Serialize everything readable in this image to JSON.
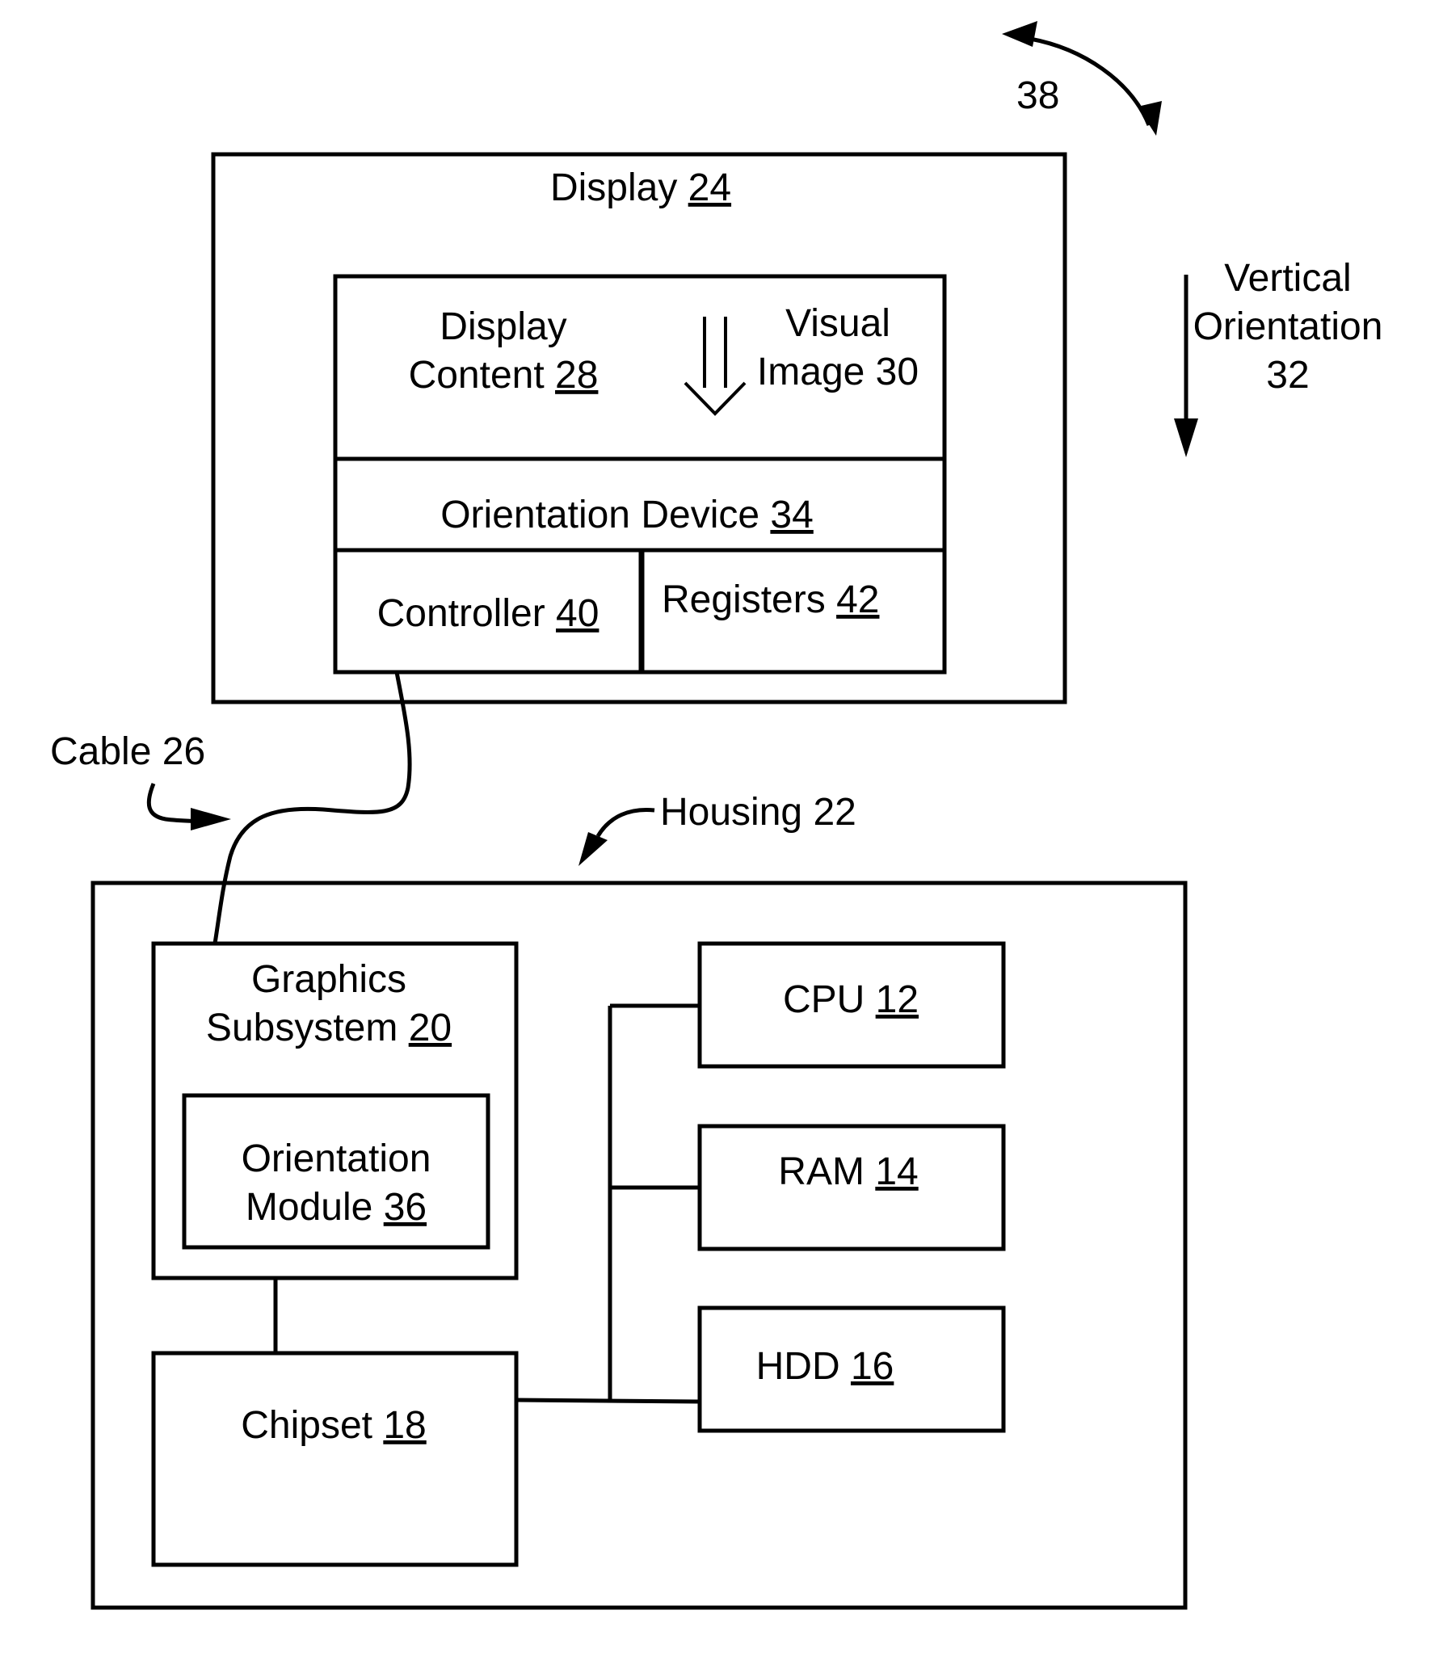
{
  "figure": {
    "display": {
      "name": "Display",
      "ref": "24"
    },
    "display_content": {
      "line1": "Display",
      "line2": "Content",
      "ref": "28"
    },
    "visual_image": {
      "line1": "Visual",
      "line2": "Image 30"
    },
    "orientation_device": {
      "name": "Orientation Device",
      "ref": "34"
    },
    "controller": {
      "name": "Controller",
      "ref": "40"
    },
    "registers": {
      "name": "Registers",
      "ref": "42"
    },
    "rotation_label": "38",
    "vertical_orientation": {
      "line1": "Vertical",
      "line2": "Orientation",
      "line3": "32"
    },
    "cable_label": "Cable 26",
    "housing_label": "Housing 22",
    "graphics_subsystem": {
      "line1": "Graphics",
      "line2": "Subsystem",
      "ref": "20"
    },
    "orientation_module": {
      "line1": "Orientation",
      "line2": "Module",
      "ref": "36"
    },
    "chipset": {
      "name": "Chipset",
      "ref": "18"
    },
    "cpu": {
      "name": "CPU",
      "ref": "12"
    },
    "ram": {
      "name": "RAM",
      "ref": "14"
    },
    "hdd": {
      "name": "HDD",
      "ref": "16"
    }
  }
}
